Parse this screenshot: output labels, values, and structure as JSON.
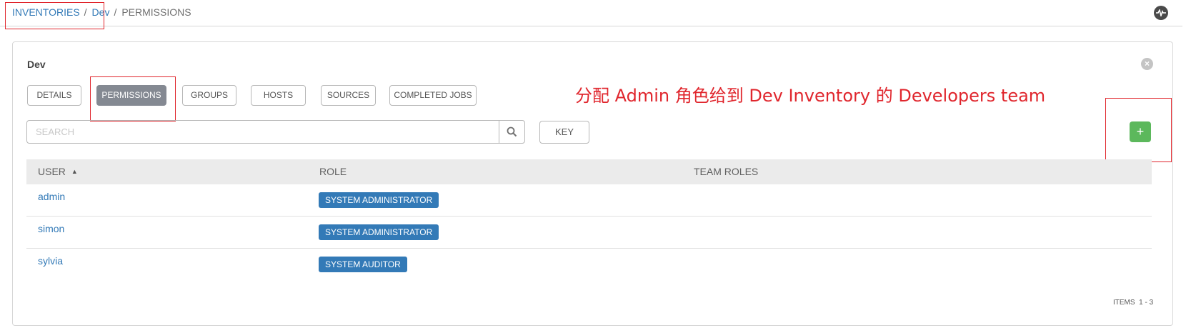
{
  "breadcrumb": {
    "inventories": "INVENTORIES",
    "dev": "Dev",
    "permissions": "PERMISSIONS",
    "separator": "/"
  },
  "panel": {
    "title": "Dev",
    "tabs": [
      "DETAILS",
      "PERMISSIONS",
      "GROUPS",
      "HOSTS",
      "SOURCES",
      "COMPLETED JOBS"
    ],
    "active_tab": "PERMISSIONS"
  },
  "annotation": "分配 Admin 角色给到 Dev Inventory 的 Developers team",
  "search": {
    "placeholder": "SEARCH",
    "key_label": "KEY"
  },
  "add_button_label": "+",
  "table": {
    "columns": [
      "USER",
      "ROLE",
      "TEAM ROLES"
    ],
    "rows": [
      {
        "user": "admin",
        "role": "SYSTEM ADMINISTRATOR"
      },
      {
        "user": "simon",
        "role": "SYSTEM ADMINISTRATOR"
      },
      {
        "user": "sylvia",
        "role": "SYSTEM AUDITOR"
      }
    ]
  },
  "pagination": {
    "label": "ITEMS",
    "range": "1 - 3"
  },
  "colors": {
    "link": "#337ab7",
    "active_tab": "#848992",
    "add_button": "#5cb85c",
    "annotation": "#e0262d"
  },
  "icons": {
    "activity": "activity-stream-icon",
    "close": "close-icon",
    "search": "search-icon",
    "sort": "sort-ascending-icon"
  }
}
